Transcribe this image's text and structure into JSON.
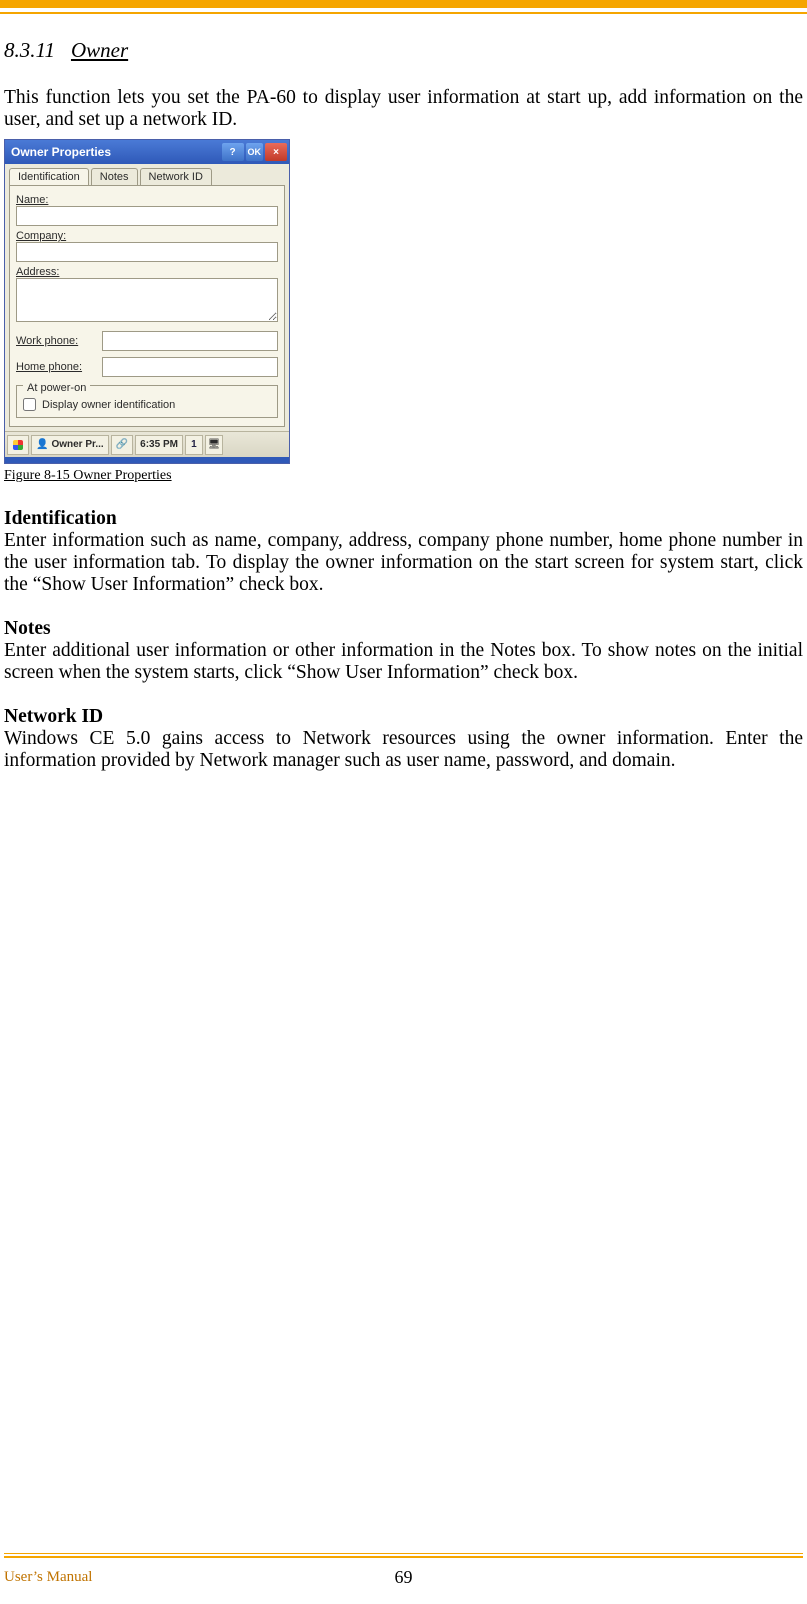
{
  "section": {
    "number": "8.3.11",
    "title": "Owner"
  },
  "intro": "This function lets you set the PA-60 to display user information at start up, add information on the user, and set up a network ID.",
  "ownerprops": {
    "window_title": "Owner Properties",
    "help_label": "?",
    "ok_label": "OK",
    "close_label": "×",
    "tabs": {
      "identification": "Identification",
      "notes": "Notes",
      "networkid": "Network ID"
    },
    "labels": {
      "name": "Name:",
      "company": "Company:",
      "address": "Address:",
      "work_phone": "Work phone:",
      "home_phone": "Home phone:",
      "at_poweron": "At power-on",
      "display_owner": "Display owner identification"
    },
    "taskbar": {
      "owner_item": "Owner Pr...",
      "clock": "6:35 PM",
      "num": "1"
    }
  },
  "figure_caption": "Figure 8-15 Owner Properties",
  "identification": {
    "head": "Identification",
    "body": "Enter information such as name, company, address, company phone number, home phone number in the user information tab. To display the owner information on the start screen for system start, click the “Show User Information” check box."
  },
  "notes": {
    "head": "Notes",
    "body": "Enter additional user information or other information in the Notes box. To show notes on the initial screen when the system starts, click “Show User Information” check box."
  },
  "networkid": {
    "head": "Network ID",
    "body": "Windows CE 5.0 gains access to Network resources using the owner information. Enter the information provided by Network manager such as user name, password, and domain."
  },
  "footer": {
    "label": "User’s Manual",
    "pagenum": "69"
  }
}
